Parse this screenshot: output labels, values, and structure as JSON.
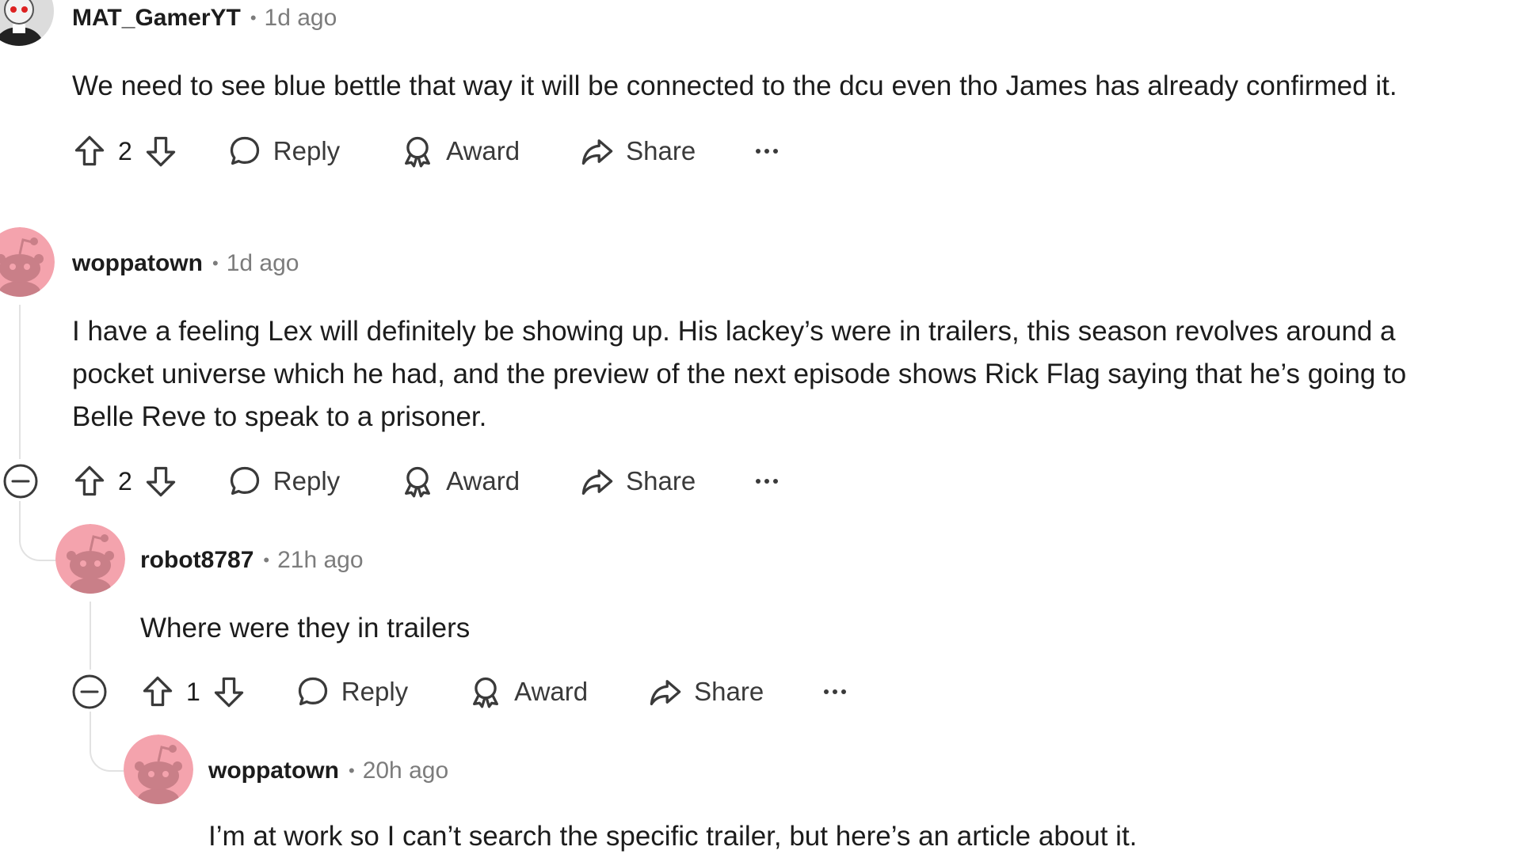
{
  "comments": [
    {
      "author": "MAT_GamerYT",
      "separator": "•",
      "time": "1d ago",
      "text": "We need to see blue bettle that way it will be connected to the dcu even tho James has already confirmed it.",
      "votes": "2",
      "actions": {
        "reply": "Reply",
        "award": "Award",
        "share": "Share",
        "more": "···"
      }
    },
    {
      "author": "woppatown",
      "separator": "•",
      "time": "1d ago",
      "text_lines": [
        "I have a feeling Lex will definitely be showing up. His lackey’s were in trailers, this season revolves around a",
        "pocket universe which he had, and the preview of the next episode shows Rick Flag saying that he’s going to",
        "Belle Reve to speak to a prisoner."
      ],
      "votes": "2",
      "actions": {
        "reply": "Reply",
        "award": "Award",
        "share": "Share",
        "more": "···"
      }
    },
    {
      "author": "robot8787",
      "separator": "•",
      "time": "21h ago",
      "text": "Where were they in trailers",
      "votes": "1",
      "actions": {
        "reply": "Reply",
        "award": "Award",
        "share": "Share",
        "more": "···"
      }
    },
    {
      "author": "woppatown",
      "separator": "•",
      "time": "20h ago",
      "text": "I’m at work so I can’t search the specific trailer, but here’s an article about it."
    }
  ],
  "colors": {
    "avatar_pink": "#f4a3ad",
    "snoo_body": "#c97f88",
    "thread_line": "#e2e2e2",
    "muted_text": "#7c7c7c"
  },
  "icons": [
    "upvote-icon",
    "downvote-icon",
    "comment-icon",
    "award-icon",
    "share-icon",
    "collapse-icon",
    "more-icon"
  ]
}
